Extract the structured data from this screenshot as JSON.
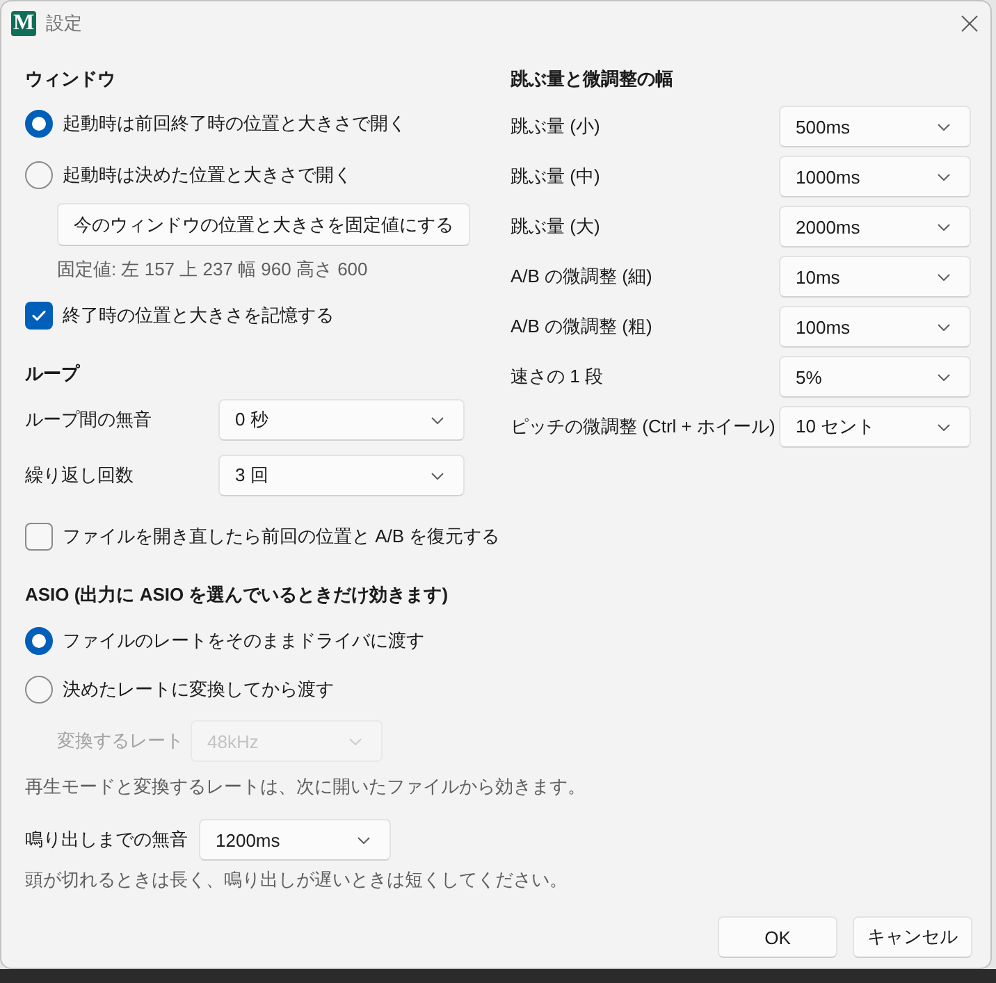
{
  "window": {
    "title": "設定",
    "icon_letter": "M"
  },
  "window_section": {
    "heading": "ウィンドウ",
    "startup_position": [
      {
        "label": "起動時は前回終了時の位置と大きさで開く",
        "selected": true
      },
      {
        "label": "起動時は決めた位置と大きさで開く",
        "selected": false
      }
    ],
    "fix_button": "今のウィンドウの位置と大きさを固定値にする",
    "fixed_value": "固定値: 左 157 上 237 幅 960 高さ 600",
    "remember_on_exit": {
      "label": "終了時の位置と大きさを記憶する",
      "checked": true
    }
  },
  "loop_section": {
    "heading": "ループ",
    "fields": [
      {
        "label": "ループ間の無音",
        "value": "0 秒"
      },
      {
        "label": "繰り返し回数",
        "value": "3 回"
      }
    ],
    "restore_on_reopen": {
      "label": "ファイルを開き直したら前回の位置と A/B を復元する",
      "checked": false
    }
  },
  "asio_section": {
    "heading": "ASIO (出力に ASIO を選んでいるときだけ効きます)",
    "rate_mode": [
      {
        "label": "ファイルのレートをそのままドライバに渡す",
        "selected": true
      },
      {
        "label": "決めたレートに変換してから渡す",
        "selected": false
      }
    ],
    "conversion_rate": {
      "label": "変換するレート",
      "value": "48kHz",
      "disabled": true
    },
    "rate_note": "再生モードと変換するレートは、次に開いたファイルから効きます。",
    "start_silence": {
      "label": "鳴り出しまでの無音",
      "value": "1200ms"
    },
    "silence_note": "頭が切れるときは長く、鳴り出しが遅いときは短くしてください。"
  },
  "jump_section": {
    "heading": "跳ぶ量と微調整の幅",
    "fields": [
      {
        "label": "跳ぶ量 (小)",
        "value": "500ms"
      },
      {
        "label": "跳ぶ量 (中)",
        "value": "1000ms"
      },
      {
        "label": "跳ぶ量 (大)",
        "value": "2000ms"
      },
      {
        "label": "A/B の微調整 (細)",
        "value": "10ms"
      },
      {
        "label": "A/B の微調整 (粗)",
        "value": "100ms"
      },
      {
        "label": "速さの 1 段",
        "value": "5%"
      },
      {
        "label": "ピッチの微調整 (Ctrl + ホイール)",
        "value": "10 セント"
      }
    ]
  },
  "buttons": [
    {
      "label": "OK"
    },
    {
      "label": "キャンセル"
    }
  ]
}
